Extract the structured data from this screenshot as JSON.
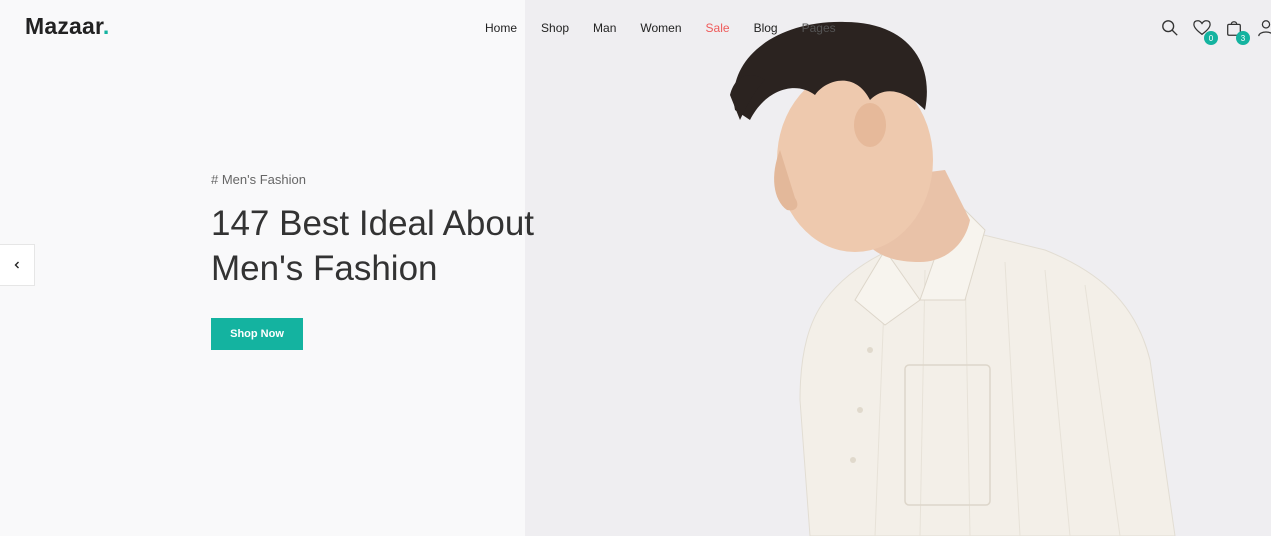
{
  "brand": {
    "name": "Mazaar",
    "dot": ".",
    "accent": "#14b3a0"
  },
  "nav": {
    "items": [
      {
        "label": "Home"
      },
      {
        "label": "Shop"
      },
      {
        "label": "Man"
      },
      {
        "label": "Women"
      },
      {
        "label": "Sale"
      },
      {
        "label": "Blog"
      },
      {
        "label": "Pages"
      }
    ],
    "sale_color": "#ef5a5a"
  },
  "header_icons": {
    "search": "search-icon",
    "wishlist": {
      "icon": "heart-icon",
      "count": "0"
    },
    "cart": {
      "icon": "shopping-bag-icon",
      "count": "3"
    },
    "account": "user-icon"
  },
  "hero": {
    "tag": "# Men's Fashion",
    "headline": "147 Best Ideal About Men's Fashion",
    "button_label": "Shop Now"
  }
}
